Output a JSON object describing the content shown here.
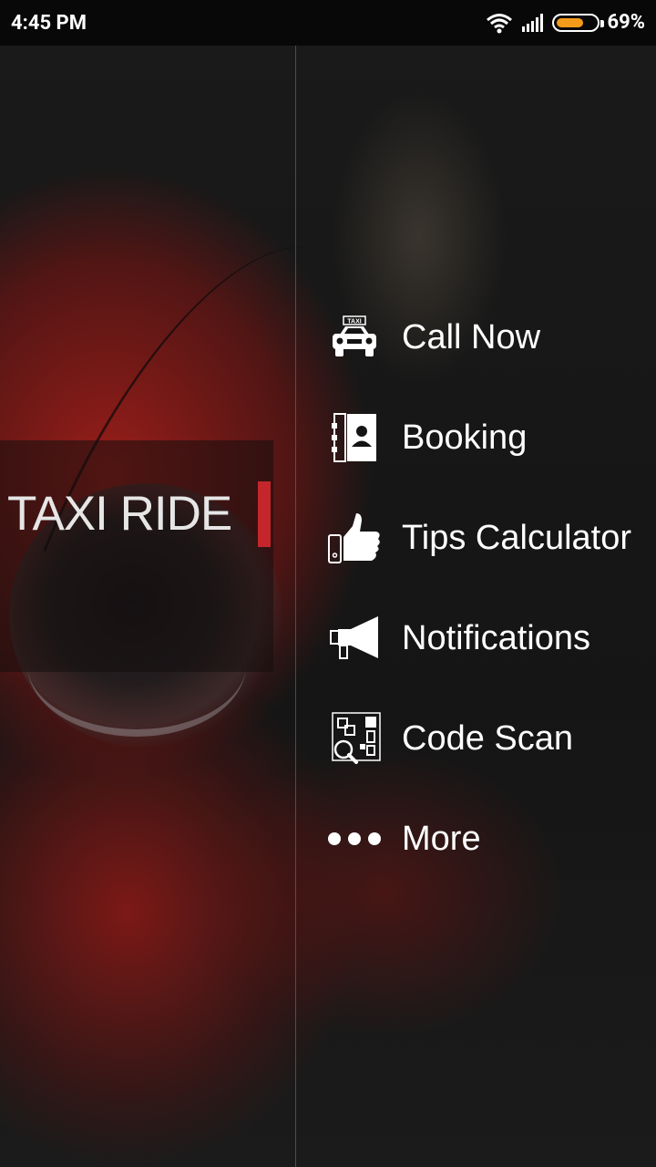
{
  "status_bar": {
    "time": "4:45 PM",
    "battery_percent": "69%",
    "battery_level": 0.69
  },
  "logo": {
    "text": "TAXI RIDE"
  },
  "menu": {
    "items": [
      {
        "label": "Call Now",
        "icon": "taxi-icon",
        "badge": "TAXI"
      },
      {
        "label": "Booking",
        "icon": "contact-book-icon"
      },
      {
        "label": "Tips Calculator",
        "icon": "thumbs-up-icon"
      },
      {
        "label": "Notifications",
        "icon": "megaphone-icon"
      },
      {
        "label": "Code Scan",
        "icon": "qr-scan-icon"
      },
      {
        "label": "More",
        "icon": "more-dots-icon"
      }
    ]
  },
  "colors": {
    "accent": "#c4262c",
    "battery": "#f29b1b"
  }
}
